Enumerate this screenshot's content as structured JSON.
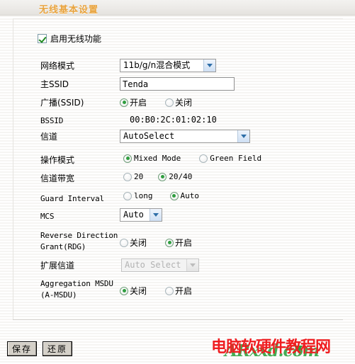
{
  "header": {
    "title": "无线基本设置"
  },
  "enable": {
    "label": "启用无线功能",
    "checked": true
  },
  "rows": {
    "network_mode": {
      "label": "网络模式",
      "value": "11b/g/n混合模式"
    },
    "main_ssid": {
      "label": "主SSID",
      "value": "Tenda",
      "placeholder": ""
    },
    "broadcast_ssid": {
      "label": "广播(SSID)",
      "options": [
        "开启",
        "关闭"
      ],
      "selected": "开启"
    },
    "bssid": {
      "label": "BSSID",
      "value": "00:B0:2C:01:02:10"
    },
    "channel": {
      "label": "信道",
      "value": "AutoSelect"
    },
    "operation_mode": {
      "label": "操作模式",
      "options": [
        "Mixed Mode",
        "Green Field"
      ],
      "selected": "Mixed Mode"
    },
    "channel_bandwidth": {
      "label": "信道带宽",
      "options": [
        "20",
        "20/40"
      ],
      "selected": "20/40"
    },
    "guard_interval": {
      "label": "Guard Interval",
      "options": [
        "long",
        "Auto"
      ],
      "selected": "Auto"
    },
    "mcs": {
      "label": "MCS",
      "value": "Auto"
    },
    "rdg": {
      "label_line1": "Reverse Direction",
      "label_line2": "Grant(RDG)",
      "options": [
        "关闭",
        "开启"
      ],
      "selected": "开启"
    },
    "extension_channel": {
      "label": "扩展信道",
      "value": "Auto Select",
      "disabled": true
    },
    "amsdu": {
      "label_line1": "Aggregation MSDU",
      "label_line2": "(A-MSDU)",
      "options": [
        "关闭",
        "开启"
      ],
      "selected": "关闭"
    }
  },
  "footer": {
    "save_label": "保存",
    "restore_label": "还原"
  },
  "watermark": {
    "red_text": "电脑软硬件教程网",
    "green_text": "ARxxd.com"
  },
  "colors": {
    "header_title": "#e8a33d",
    "radio_dot": "#2f9e3f",
    "check": "#1f8a1f",
    "watermark_red": "#ef1d20",
    "watermark_green": "#3aa84a"
  }
}
